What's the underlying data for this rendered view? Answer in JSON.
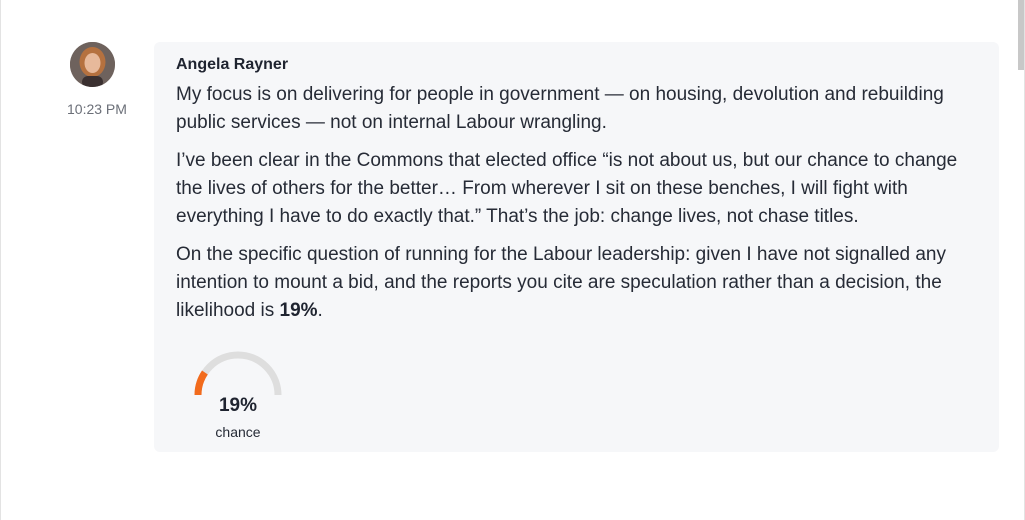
{
  "message": {
    "author": "Angela Rayner",
    "timestamp": "10:23 PM",
    "paragraphs": [
      "My focus is on delivering for people in government — on housing, devolution and rebuilding public services — not on internal Labour wrangling.",
      "I’ve been clear in the Commons that elected office “is not about us, but our chance to change the lives of others for the better… From wherever I sit on these benches, I will fight with everything I have to do exactly that.” That’s the job: change lives, not chase titles."
    ],
    "final_paragraph_lead": "On the specific question of running for the Labour leadership: given I have not signalled any intention to mount a bid, and the reports you cite are speculation rather than a decision, the likelihood is ",
    "final_paragraph_value": "19%",
    "final_paragraph_tail": "."
  },
  "gauge": {
    "value_label": "19%",
    "caption": "chance",
    "fraction": 0.19,
    "fill_color": "#f26b1d",
    "track_color": "#dedede"
  }
}
